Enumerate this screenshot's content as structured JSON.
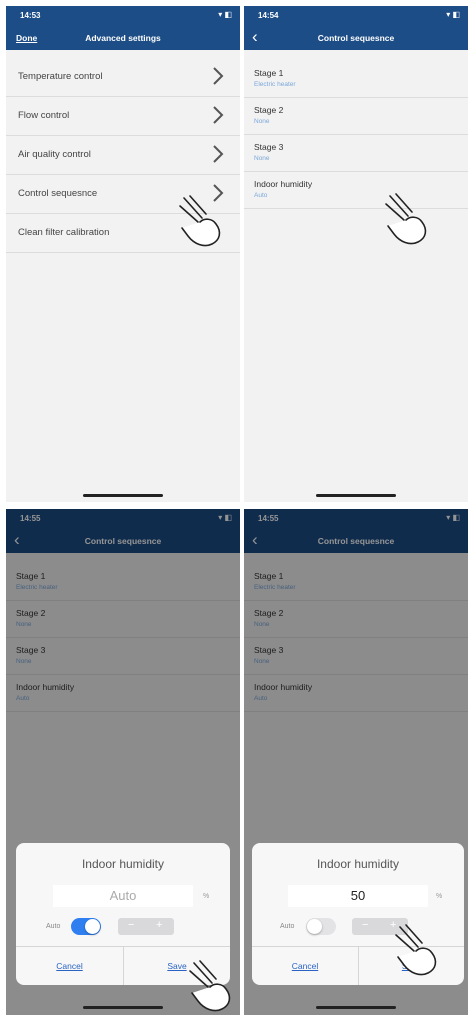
{
  "screen1": {
    "time": "14:53",
    "nav": {
      "done": "Done",
      "title": "Advanced settings"
    },
    "rows": [
      {
        "label": "Temperature control"
      },
      {
        "label": "Flow control"
      },
      {
        "label": "Air quality control"
      },
      {
        "label": "Control sequesnce"
      },
      {
        "label": "Clean filter calibration"
      }
    ]
  },
  "screen2": {
    "time": "14:54",
    "nav": {
      "title": "Control sequesnce"
    },
    "stages": [
      {
        "title": "Stage 1",
        "value": "Electric heater"
      },
      {
        "title": "Stage 2",
        "value": "None"
      },
      {
        "title": "Stage 3",
        "value": "None"
      },
      {
        "title": "Indoor humidity",
        "value": "Auto"
      }
    ]
  },
  "screen3": {
    "time": "14:55",
    "nav": {
      "title": "Control sequesnce"
    },
    "dialog": {
      "title": "Indoor humidity",
      "value": "Auto",
      "unit": "%",
      "auto_label": "Auto",
      "auto_on": true,
      "stepper": {
        "minus": "−",
        "plus": "+"
      },
      "cancel": "Cancel",
      "save": "Save"
    }
  },
  "screen4": {
    "time": "14:55",
    "nav": {
      "title": "Control sequesnce"
    },
    "dialog": {
      "title": "Indoor humidity",
      "value": "50",
      "unit": "%",
      "auto_label": "Auto",
      "auto_on": false,
      "stepper": {
        "minus": "−",
        "plus": "+"
      },
      "cancel": "Cancel",
      "save": "Save"
    }
  },
  "colors": {
    "navbar": "#1c4d86",
    "accent": "#2a63c3",
    "subtitle": "#7aa7d8",
    "toggle_on": "#2f7ff0"
  },
  "icons": {
    "status": "signal-wifi-battery",
    "row_arrow": "chevron-right-icon",
    "back": "chevron-left-icon",
    "pointer": "hand-pointer-icon"
  }
}
